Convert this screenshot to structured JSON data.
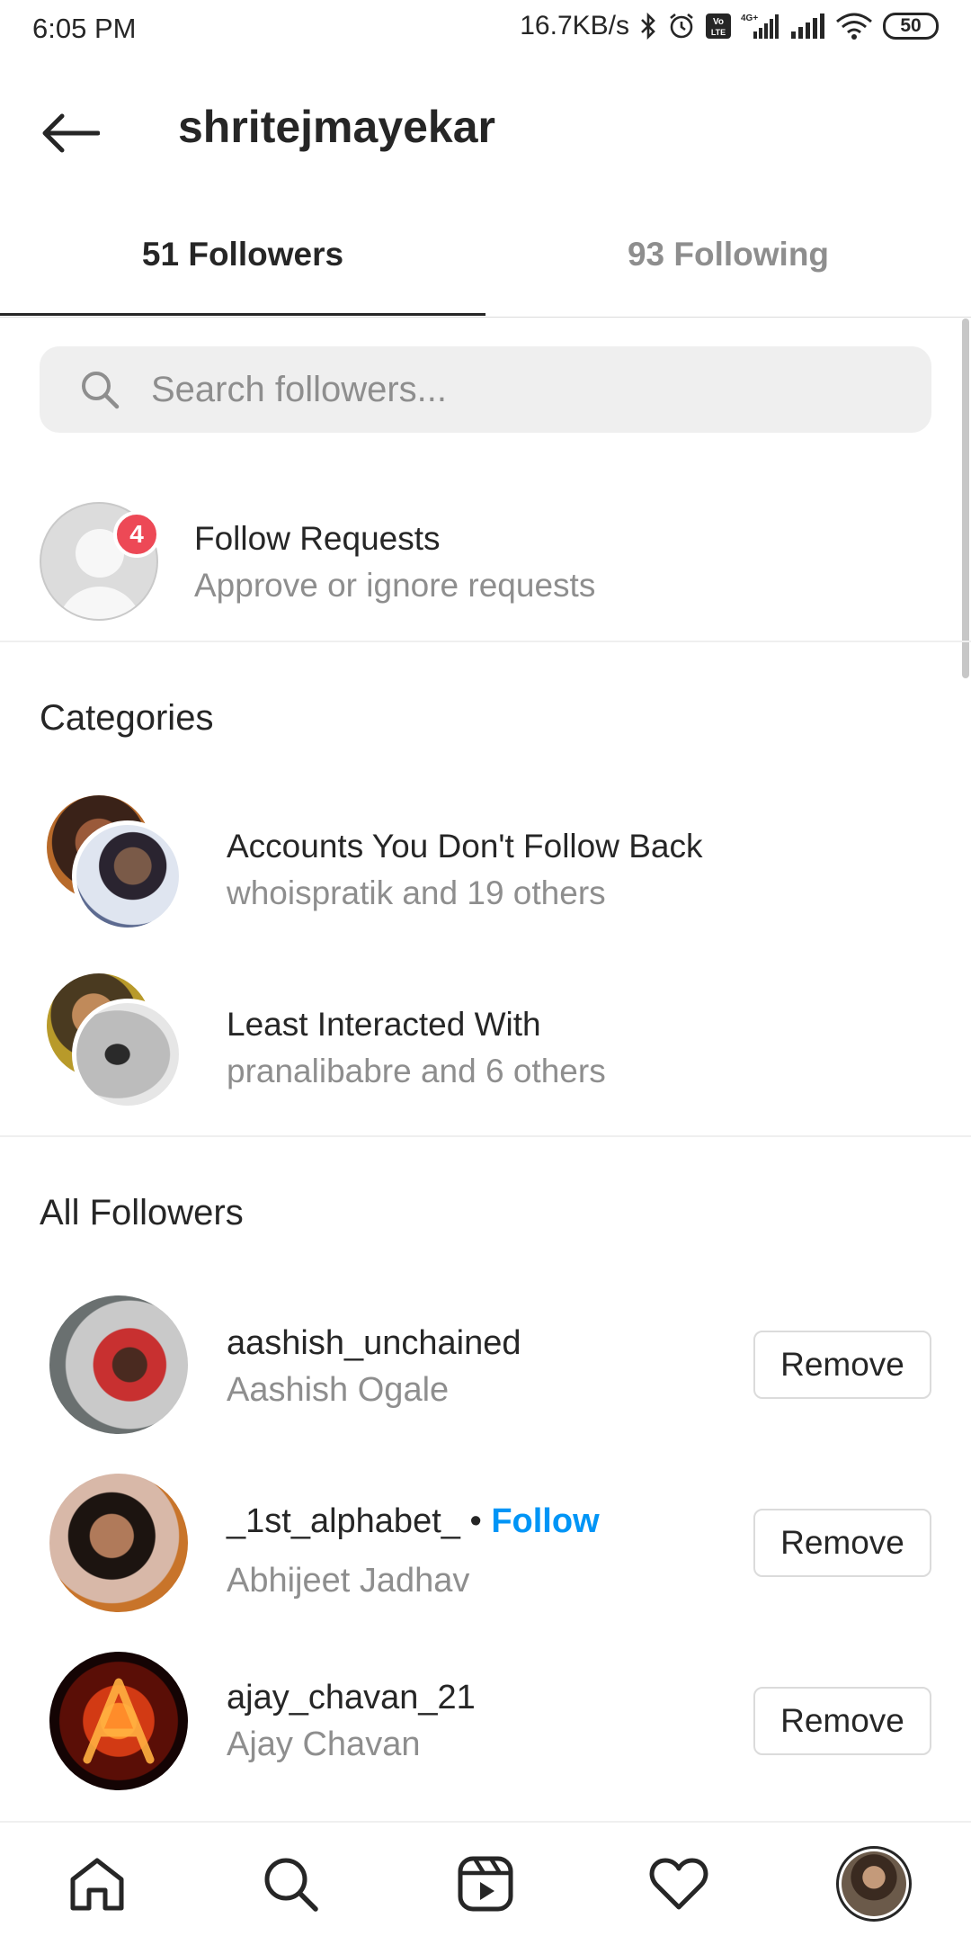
{
  "status_bar": {
    "time": "6:05 PM",
    "network_speed": "16.7KB/s",
    "battery": "50",
    "icons": [
      "bluetooth-icon",
      "alarm-icon",
      "volte-icon",
      "signal-4g-icon",
      "signal-icon",
      "wifi-icon",
      "battery-icon"
    ]
  },
  "header": {
    "title": "shritejmayekar"
  },
  "tabs": [
    {
      "label": "51 Followers",
      "active": true
    },
    {
      "label": "93 Following",
      "active": false
    }
  ],
  "search": {
    "placeholder": "Search followers..."
  },
  "follow_requests": {
    "title": "Follow Requests",
    "subtitle": "Approve or ignore requests",
    "badge": "4"
  },
  "categories": {
    "title": "Categories",
    "items": [
      {
        "title": "Accounts You Don't Follow Back",
        "subtitle": "whoispratik and 19 others"
      },
      {
        "title": "Least Interacted With",
        "subtitle": "pranalibabre and 6 others"
      }
    ]
  },
  "all_followers": {
    "title": "All Followers",
    "items": [
      {
        "username": "aashish_unchained",
        "name": "Aashish Ogale",
        "follow": "",
        "action": "Remove"
      },
      {
        "username": "_1st_alphabet_",
        "separator": " • ",
        "follow": "Follow",
        "name": "Abhijeet Jadhav",
        "action": "Remove"
      },
      {
        "username": "ajay_chavan_21",
        "name": "Ajay Chavan",
        "follow": "",
        "action": "Remove"
      }
    ]
  },
  "bottom_nav": [
    "home-icon",
    "search-icon",
    "reels-icon",
    "heart-icon",
    "profile-avatar"
  ],
  "colors": {
    "text": "#262626",
    "secondary": "#8e8e8e",
    "link": "#0095f6",
    "badge": "#ed4956",
    "search_bg": "#efefef"
  }
}
